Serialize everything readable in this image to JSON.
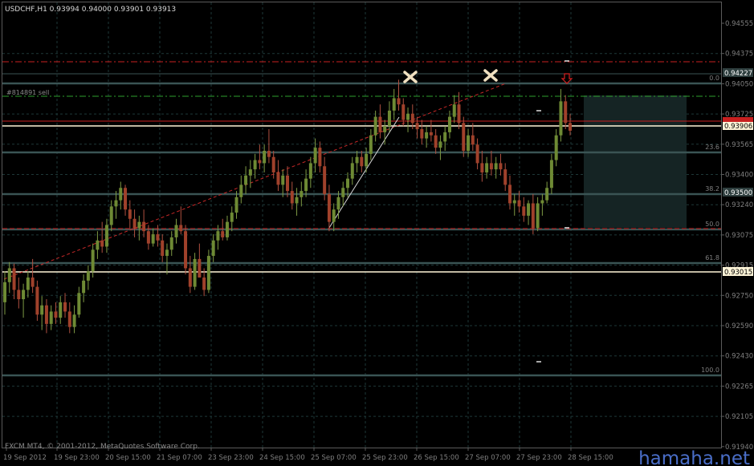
{
  "chart_data": {
    "type": "candlestick",
    "symbol_header": "USDCHF,H1  0.93994 0.94000 0.93901 0.93913",
    "copyright": "FXCM MT4, © 2001-2012, MetaQuotes Software Corp.",
    "watermark": "hamaha.net",
    "order_label": "#814891 sell",
    "ylim": [
      0.9186,
      0.9474
    ],
    "y_ticks": [
      "0.94555",
      "0.94375",
      "0.94050",
      "0.93725",
      "0.93565",
      "0.93400",
      "0.93240",
      "0.93075",
      "0.92915",
      "0.92750",
      "0.92590",
      "0.92430",
      "0.92265",
      "0.92105",
      "0.91940"
    ],
    "x_ticks": [
      "19 Sep 2012",
      "19 Sep 23:00",
      "20 Sep 15:00",
      "21 Sep 07:00",
      "23 Sep 23:00",
      "24 Sep 15:00",
      "25 Sep 07:00",
      "25 Sep 23:00",
      "26 Sep 15:00",
      "27 Sep 07:00",
      "27 Sep 23:00",
      "28 Sep 15:00"
    ],
    "price_labels": [
      {
        "text": "0.94227",
        "value": 0.94227,
        "bg": "#2e3e3e",
        "fg": "#ffffff"
      },
      {
        "text": "0.93906",
        "value": 0.93906,
        "bg": "#fff5d8",
        "fg": "#000000"
      },
      {
        "text": "0.93500",
        "value": 0.935,
        "bg": "#2e3e3e",
        "fg": "#ffffff"
      },
      {
        "text": "0.93015",
        "value": 0.93015,
        "bg": "#fff5d8",
        "fg": "#000000"
      }
    ],
    "fib_levels": [
      {
        "label": "0.0",
        "value": 0.9419
      },
      {
        "label": "23.6",
        "value": 0.9374
      },
      {
        "label": "38.2",
        "value": 0.935
      },
      {
        "label": "50.0",
        "value": 0.9326
      },
      {
        "label": "61.8",
        "value": 0.93065
      },
      {
        "label": "100.0",
        "value": 0.9239
      }
    ],
    "colors": {
      "background": "#000000",
      "bull": "#6e8a34",
      "bear": "#a0412b",
      "wick_bull": "#7e9a44",
      "wick_bear": "#b05040",
      "grid": "#1e3838",
      "fib": "#3a5454",
      "axis_text": "#7f7f7f",
      "level_red": "#c82020",
      "level_cream": "#fff5d8",
      "level_green": "#2ea02e",
      "trend_red": "#c82828",
      "box": "#152424",
      "marker": "#f0e0c0",
      "arrow": "#d02020"
    },
    "candles": [
      [
        0.928,
        0.93,
        0.9272,
        0.9293
      ],
      [
        0.9293,
        0.9306,
        0.9286,
        0.9302
      ],
      [
        0.9302,
        0.9305,
        0.9282,
        0.9288
      ],
      [
        0.9288,
        0.9296,
        0.9276,
        0.9282
      ],
      [
        0.9282,
        0.9292,
        0.927,
        0.9288
      ],
      [
        0.9288,
        0.93,
        0.9283,
        0.9296
      ],
      [
        0.9296,
        0.9308,
        0.9286,
        0.929
      ],
      [
        0.929,
        0.9294,
        0.9268,
        0.9272
      ],
      [
        0.9272,
        0.9284,
        0.9262,
        0.9278
      ],
      [
        0.9278,
        0.9282,
        0.926,
        0.9266
      ],
      [
        0.9266,
        0.9278,
        0.9262,
        0.9274
      ],
      [
        0.9274,
        0.928,
        0.9266,
        0.927
      ],
      [
        0.927,
        0.9284,
        0.9266,
        0.928
      ],
      [
        0.928,
        0.9286,
        0.927,
        0.9274
      ],
      [
        0.9274,
        0.928,
        0.926,
        0.9264
      ],
      [
        0.9264,
        0.9278,
        0.926,
        0.9272
      ],
      [
        0.9272,
        0.929,
        0.927,
        0.9286
      ],
      [
        0.9286,
        0.9298,
        0.928,
        0.9294
      ],
      [
        0.9294,
        0.9304,
        0.9288,
        0.93
      ],
      [
        0.93,
        0.9318,
        0.9296,
        0.9314
      ],
      [
        0.9314,
        0.9326,
        0.9308,
        0.932
      ],
      [
        0.932,
        0.9332,
        0.9312,
        0.9316
      ],
      [
        0.9316,
        0.9334,
        0.9312,
        0.933
      ],
      [
        0.933,
        0.9346,
        0.9326,
        0.9342
      ],
      [
        0.9342,
        0.9352,
        0.9334,
        0.9346
      ],
      [
        0.9346,
        0.9358,
        0.934,
        0.9354
      ],
      [
        0.9354,
        0.9356,
        0.9336,
        0.934
      ],
      [
        0.934,
        0.9346,
        0.9328,
        0.9334
      ],
      [
        0.9334,
        0.934,
        0.9322,
        0.9328
      ],
      [
        0.9328,
        0.9336,
        0.932,
        0.9332
      ],
      [
        0.9332,
        0.934,
        0.9322,
        0.9326
      ],
      [
        0.9326,
        0.933,
        0.9314,
        0.9318
      ],
      [
        0.9318,
        0.9328,
        0.9316,
        0.9324
      ],
      [
        0.9324,
        0.933,
        0.9316,
        0.932
      ],
      [
        0.932,
        0.9324,
        0.9306,
        0.931
      ],
      [
        0.931,
        0.9318,
        0.9298,
        0.9314
      ],
      [
        0.9314,
        0.9326,
        0.931,
        0.9322
      ],
      [
        0.9322,
        0.9334,
        0.9318,
        0.933
      ],
      [
        0.933,
        0.9342,
        0.9324,
        0.9326
      ],
      [
        0.9326,
        0.933,
        0.9298,
        0.9302
      ],
      [
        0.9302,
        0.931,
        0.9286,
        0.929
      ],
      [
        0.929,
        0.9312,
        0.9288,
        0.9308
      ],
      [
        0.9308,
        0.9318,
        0.93,
        0.9296
      ],
      [
        0.9296,
        0.9302,
        0.9284,
        0.9288
      ],
      [
        0.9288,
        0.9314,
        0.9286,
        0.931
      ],
      [
        0.931,
        0.9324,
        0.9306,
        0.932
      ],
      [
        0.932,
        0.933,
        0.9314,
        0.9326
      ],
      [
        0.9326,
        0.9334,
        0.932,
        0.9322
      ],
      [
        0.9322,
        0.9336,
        0.932,
        0.9332
      ],
      [
        0.9332,
        0.9342,
        0.9326,
        0.9338
      ],
      [
        0.9338,
        0.9352,
        0.9334,
        0.9348
      ],
      [
        0.9348,
        0.9362,
        0.9344,
        0.9356
      ],
      [
        0.9356,
        0.9368,
        0.935,
        0.9362
      ],
      [
        0.9362,
        0.9372,
        0.9354,
        0.9366
      ],
      [
        0.9366,
        0.9376,
        0.936,
        0.9372
      ],
      [
        0.9372,
        0.9382,
        0.9366,
        0.937
      ],
      [
        0.937,
        0.9382,
        0.9364,
        0.9378
      ],
      [
        0.9378,
        0.9392,
        0.937,
        0.9374
      ],
      [
        0.9374,
        0.9378,
        0.936,
        0.9364
      ],
      [
        0.9364,
        0.9372,
        0.9352,
        0.9356
      ],
      [
        0.9356,
        0.9366,
        0.9348,
        0.9362
      ],
      [
        0.9362,
        0.9368,
        0.9348,
        0.9352
      ],
      [
        0.9352,
        0.9358,
        0.934,
        0.9344
      ],
      [
        0.9344,
        0.9354,
        0.9336,
        0.9348
      ],
      [
        0.9348,
        0.9358,
        0.9342,
        0.9352
      ],
      [
        0.9352,
        0.9366,
        0.9348,
        0.936
      ],
      [
        0.936,
        0.9374,
        0.9354,
        0.937
      ],
      [
        0.937,
        0.9386,
        0.9364,
        0.938
      ],
      [
        0.938,
        0.9384,
        0.9364,
        0.9368
      ],
      [
        0.9368,
        0.9374,
        0.9346,
        0.935
      ],
      [
        0.935,
        0.9356,
        0.9326,
        0.9332
      ],
      [
        0.9332,
        0.9344,
        0.9326,
        0.934
      ],
      [
        0.934,
        0.9352,
        0.9334,
        0.9348
      ],
      [
        0.9348,
        0.9358,
        0.9342,
        0.9354
      ],
      [
        0.9354,
        0.9364,
        0.9348,
        0.936
      ],
      [
        0.936,
        0.9374,
        0.9356,
        0.937
      ],
      [
        0.937,
        0.9378,
        0.9364,
        0.9374
      ],
      [
        0.9374,
        0.9378,
        0.9364,
        0.9368
      ],
      [
        0.9368,
        0.938,
        0.9364,
        0.9376
      ],
      [
        0.9376,
        0.9392,
        0.9372,
        0.9388
      ],
      [
        0.9388,
        0.9404,
        0.9384,
        0.94
      ],
      [
        0.94,
        0.9408,
        0.9386,
        0.939
      ],
      [
        0.939,
        0.9398,
        0.9382,
        0.9394
      ],
      [
        0.9394,
        0.941,
        0.939,
        0.9404
      ],
      [
        0.9404,
        0.9418,
        0.9398,
        0.9412
      ],
      [
        0.9412,
        0.9424,
        0.9404,
        0.9408
      ],
      [
        0.9408,
        0.9412,
        0.9394,
        0.9398
      ],
      [
        0.9398,
        0.9406,
        0.939,
        0.9402
      ],
      [
        0.9402,
        0.9408,
        0.9392,
        0.9396
      ],
      [
        0.9396,
        0.94,
        0.9386,
        0.9392
      ],
      [
        0.9392,
        0.9398,
        0.9382,
        0.9386
      ],
      [
        0.9386,
        0.9394,
        0.938,
        0.939
      ],
      [
        0.939,
        0.9398,
        0.9384,
        0.9388
      ],
      [
        0.9388,
        0.9392,
        0.9376,
        0.938
      ],
      [
        0.938,
        0.9388,
        0.9372,
        0.9384
      ],
      [
        0.9384,
        0.9394,
        0.9378,
        0.939
      ],
      [
        0.939,
        0.9404,
        0.9386,
        0.94
      ],
      [
        0.94,
        0.9414,
        0.9396,
        0.9408
      ],
      [
        0.9408,
        0.9416,
        0.9392,
        0.9396
      ],
      [
        0.9396,
        0.94,
        0.9374,
        0.9378
      ],
      [
        0.9378,
        0.9392,
        0.9374,
        0.9388
      ],
      [
        0.9388,
        0.9396,
        0.9378,
        0.9382
      ],
      [
        0.9382,
        0.9386,
        0.9366,
        0.937
      ],
      [
        0.937,
        0.9378,
        0.9358,
        0.9364
      ],
      [
        0.9364,
        0.9374,
        0.936,
        0.937
      ],
      [
        0.937,
        0.9378,
        0.9362,
        0.9366
      ],
      [
        0.9366,
        0.9374,
        0.936,
        0.937
      ],
      [
        0.937,
        0.9376,
        0.9362,
        0.9366
      ],
      [
        0.9366,
        0.937,
        0.9352,
        0.9356
      ],
      [
        0.9356,
        0.9362,
        0.934,
        0.9344
      ],
      [
        0.9344,
        0.935,
        0.9336,
        0.9346
      ],
      [
        0.9346,
        0.9352,
        0.9338,
        0.9342
      ],
      [
        0.9342,
        0.9348,
        0.9332,
        0.9336
      ],
      [
        0.9336,
        0.9346,
        0.933,
        0.9344
      ],
      [
        0.9344,
        0.935,
        0.9324,
        0.9328
      ],
      [
        0.9328,
        0.9348,
        0.9326,
        0.9344
      ],
      [
        0.9344,
        0.935,
        0.9336,
        0.9346
      ],
      [
        0.9346,
        0.9358,
        0.9344,
        0.9354
      ],
      [
        0.9354,
        0.9376,
        0.935,
        0.9372
      ],
      [
        0.9372,
        0.9392,
        0.9368,
        0.9388
      ],
      [
        0.9388,
        0.9418,
        0.9384,
        0.941
      ],
      [
        0.941,
        0.9414,
        0.9392,
        0.9396
      ],
      [
        0.9396,
        0.9402,
        0.9388,
        0.9391
      ]
    ]
  }
}
